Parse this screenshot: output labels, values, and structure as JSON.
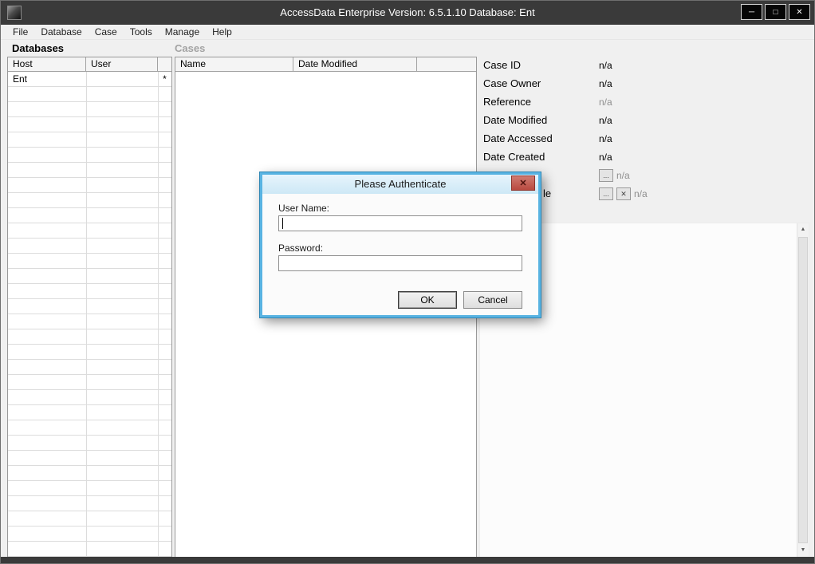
{
  "titlebar": {
    "title": "AccessData Enterprise Version: 6.5.1.10 Database: Ent",
    "minimize_icon": "─",
    "maximize_icon": "□",
    "close_icon": "✕"
  },
  "menubar": {
    "items": [
      "File",
      "Database",
      "Case",
      "Tools",
      "Manage",
      "Help"
    ]
  },
  "sections": {
    "databases_title": "Databases",
    "cases_title": "Cases"
  },
  "databases_table": {
    "columns": [
      "Host",
      "User"
    ],
    "rows": [
      {
        "host": "Ent",
        "user": "",
        "marker": "*"
      }
    ]
  },
  "cases_table": {
    "columns": [
      "Name",
      "Date Modified"
    ]
  },
  "details": {
    "browse_icon": "...",
    "clear_icon": "✕",
    "fields": [
      {
        "label": "Case ID",
        "value": "n/a"
      },
      {
        "label": "Case Owner",
        "value": "n/a"
      },
      {
        "label": "Reference",
        "value": "n/a"
      },
      {
        "label": "Date Modified",
        "value": "n/a"
      },
      {
        "label": "Date Accessed",
        "value": "n/a"
      },
      {
        "label": "Date Created",
        "value": "n/a"
      },
      {
        "label": "",
        "value": "n/a"
      },
      {
        "label": "le",
        "value": "n/a"
      }
    ]
  },
  "scrollbar": {
    "up_icon": "▲",
    "down_icon": "▼"
  },
  "dialog": {
    "title": "Please Authenticate",
    "close_icon": "✕",
    "username_label": "User Name:",
    "username_value": "",
    "password_label": "Password:",
    "password_value": "",
    "ok_label": "OK",
    "cancel_label": "Cancel"
  }
}
